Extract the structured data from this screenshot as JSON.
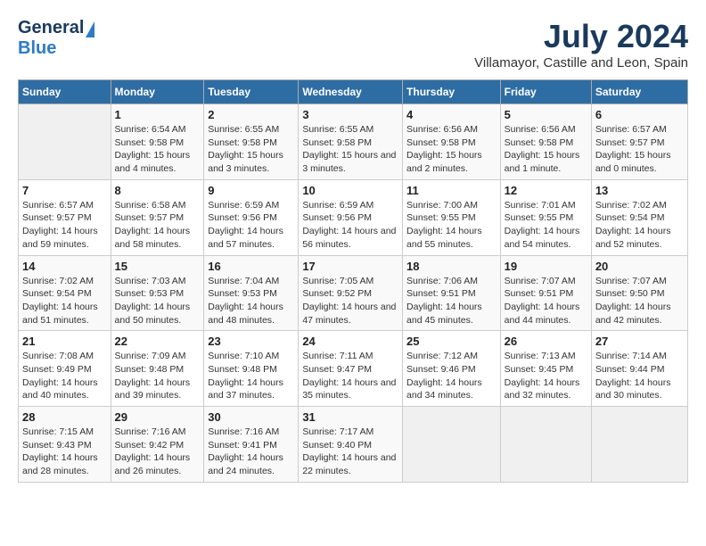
{
  "logo": {
    "general": "General",
    "blue": "Blue"
  },
  "title": {
    "month_year": "July 2024",
    "location": "Villamayor, Castille and Leon, Spain"
  },
  "headers": [
    "Sunday",
    "Monday",
    "Tuesday",
    "Wednesday",
    "Thursday",
    "Friday",
    "Saturday"
  ],
  "weeks": [
    [
      {
        "day": "",
        "sunrise": "",
        "sunset": "",
        "daylight": ""
      },
      {
        "day": "1",
        "sunrise": "Sunrise: 6:54 AM",
        "sunset": "Sunset: 9:58 PM",
        "daylight": "Daylight: 15 hours and 4 minutes."
      },
      {
        "day": "2",
        "sunrise": "Sunrise: 6:55 AM",
        "sunset": "Sunset: 9:58 PM",
        "daylight": "Daylight: 15 hours and 3 minutes."
      },
      {
        "day": "3",
        "sunrise": "Sunrise: 6:55 AM",
        "sunset": "Sunset: 9:58 PM",
        "daylight": "Daylight: 15 hours and 3 minutes."
      },
      {
        "day": "4",
        "sunrise": "Sunrise: 6:56 AM",
        "sunset": "Sunset: 9:58 PM",
        "daylight": "Daylight: 15 hours and 2 minutes."
      },
      {
        "day": "5",
        "sunrise": "Sunrise: 6:56 AM",
        "sunset": "Sunset: 9:58 PM",
        "daylight": "Daylight: 15 hours and 1 minute."
      },
      {
        "day": "6",
        "sunrise": "Sunrise: 6:57 AM",
        "sunset": "Sunset: 9:57 PM",
        "daylight": "Daylight: 15 hours and 0 minutes."
      }
    ],
    [
      {
        "day": "7",
        "sunrise": "Sunrise: 6:57 AM",
        "sunset": "Sunset: 9:57 PM",
        "daylight": "Daylight: 14 hours and 59 minutes."
      },
      {
        "day": "8",
        "sunrise": "Sunrise: 6:58 AM",
        "sunset": "Sunset: 9:57 PM",
        "daylight": "Daylight: 14 hours and 58 minutes."
      },
      {
        "day": "9",
        "sunrise": "Sunrise: 6:59 AM",
        "sunset": "Sunset: 9:56 PM",
        "daylight": "Daylight: 14 hours and 57 minutes."
      },
      {
        "day": "10",
        "sunrise": "Sunrise: 6:59 AM",
        "sunset": "Sunset: 9:56 PM",
        "daylight": "Daylight: 14 hours and 56 minutes."
      },
      {
        "day": "11",
        "sunrise": "Sunrise: 7:00 AM",
        "sunset": "Sunset: 9:55 PM",
        "daylight": "Daylight: 14 hours and 55 minutes."
      },
      {
        "day": "12",
        "sunrise": "Sunrise: 7:01 AM",
        "sunset": "Sunset: 9:55 PM",
        "daylight": "Daylight: 14 hours and 54 minutes."
      },
      {
        "day": "13",
        "sunrise": "Sunrise: 7:02 AM",
        "sunset": "Sunset: 9:54 PM",
        "daylight": "Daylight: 14 hours and 52 minutes."
      }
    ],
    [
      {
        "day": "14",
        "sunrise": "Sunrise: 7:02 AM",
        "sunset": "Sunset: 9:54 PM",
        "daylight": "Daylight: 14 hours and 51 minutes."
      },
      {
        "day": "15",
        "sunrise": "Sunrise: 7:03 AM",
        "sunset": "Sunset: 9:53 PM",
        "daylight": "Daylight: 14 hours and 50 minutes."
      },
      {
        "day": "16",
        "sunrise": "Sunrise: 7:04 AM",
        "sunset": "Sunset: 9:53 PM",
        "daylight": "Daylight: 14 hours and 48 minutes."
      },
      {
        "day": "17",
        "sunrise": "Sunrise: 7:05 AM",
        "sunset": "Sunset: 9:52 PM",
        "daylight": "Daylight: 14 hours and 47 minutes."
      },
      {
        "day": "18",
        "sunrise": "Sunrise: 7:06 AM",
        "sunset": "Sunset: 9:51 PM",
        "daylight": "Daylight: 14 hours and 45 minutes."
      },
      {
        "day": "19",
        "sunrise": "Sunrise: 7:07 AM",
        "sunset": "Sunset: 9:51 PM",
        "daylight": "Daylight: 14 hours and 44 minutes."
      },
      {
        "day": "20",
        "sunrise": "Sunrise: 7:07 AM",
        "sunset": "Sunset: 9:50 PM",
        "daylight": "Daylight: 14 hours and 42 minutes."
      }
    ],
    [
      {
        "day": "21",
        "sunrise": "Sunrise: 7:08 AM",
        "sunset": "Sunset: 9:49 PM",
        "daylight": "Daylight: 14 hours and 40 minutes."
      },
      {
        "day": "22",
        "sunrise": "Sunrise: 7:09 AM",
        "sunset": "Sunset: 9:48 PM",
        "daylight": "Daylight: 14 hours and 39 minutes."
      },
      {
        "day": "23",
        "sunrise": "Sunrise: 7:10 AM",
        "sunset": "Sunset: 9:48 PM",
        "daylight": "Daylight: 14 hours and 37 minutes."
      },
      {
        "day": "24",
        "sunrise": "Sunrise: 7:11 AM",
        "sunset": "Sunset: 9:47 PM",
        "daylight": "Daylight: 14 hours and 35 minutes."
      },
      {
        "day": "25",
        "sunrise": "Sunrise: 7:12 AM",
        "sunset": "Sunset: 9:46 PM",
        "daylight": "Daylight: 14 hours and 34 minutes."
      },
      {
        "day": "26",
        "sunrise": "Sunrise: 7:13 AM",
        "sunset": "Sunset: 9:45 PM",
        "daylight": "Daylight: 14 hours and 32 minutes."
      },
      {
        "day": "27",
        "sunrise": "Sunrise: 7:14 AM",
        "sunset": "Sunset: 9:44 PM",
        "daylight": "Daylight: 14 hours and 30 minutes."
      }
    ],
    [
      {
        "day": "28",
        "sunrise": "Sunrise: 7:15 AM",
        "sunset": "Sunset: 9:43 PM",
        "daylight": "Daylight: 14 hours and 28 minutes."
      },
      {
        "day": "29",
        "sunrise": "Sunrise: 7:16 AM",
        "sunset": "Sunset: 9:42 PM",
        "daylight": "Daylight: 14 hours and 26 minutes."
      },
      {
        "day": "30",
        "sunrise": "Sunrise: 7:16 AM",
        "sunset": "Sunset: 9:41 PM",
        "daylight": "Daylight: 14 hours and 24 minutes."
      },
      {
        "day": "31",
        "sunrise": "Sunrise: 7:17 AM",
        "sunset": "Sunset: 9:40 PM",
        "daylight": "Daylight: 14 hours and 22 minutes."
      },
      {
        "day": "",
        "sunrise": "",
        "sunset": "",
        "daylight": ""
      },
      {
        "day": "",
        "sunrise": "",
        "sunset": "",
        "daylight": ""
      },
      {
        "day": "",
        "sunrise": "",
        "sunset": "",
        "daylight": ""
      }
    ]
  ]
}
